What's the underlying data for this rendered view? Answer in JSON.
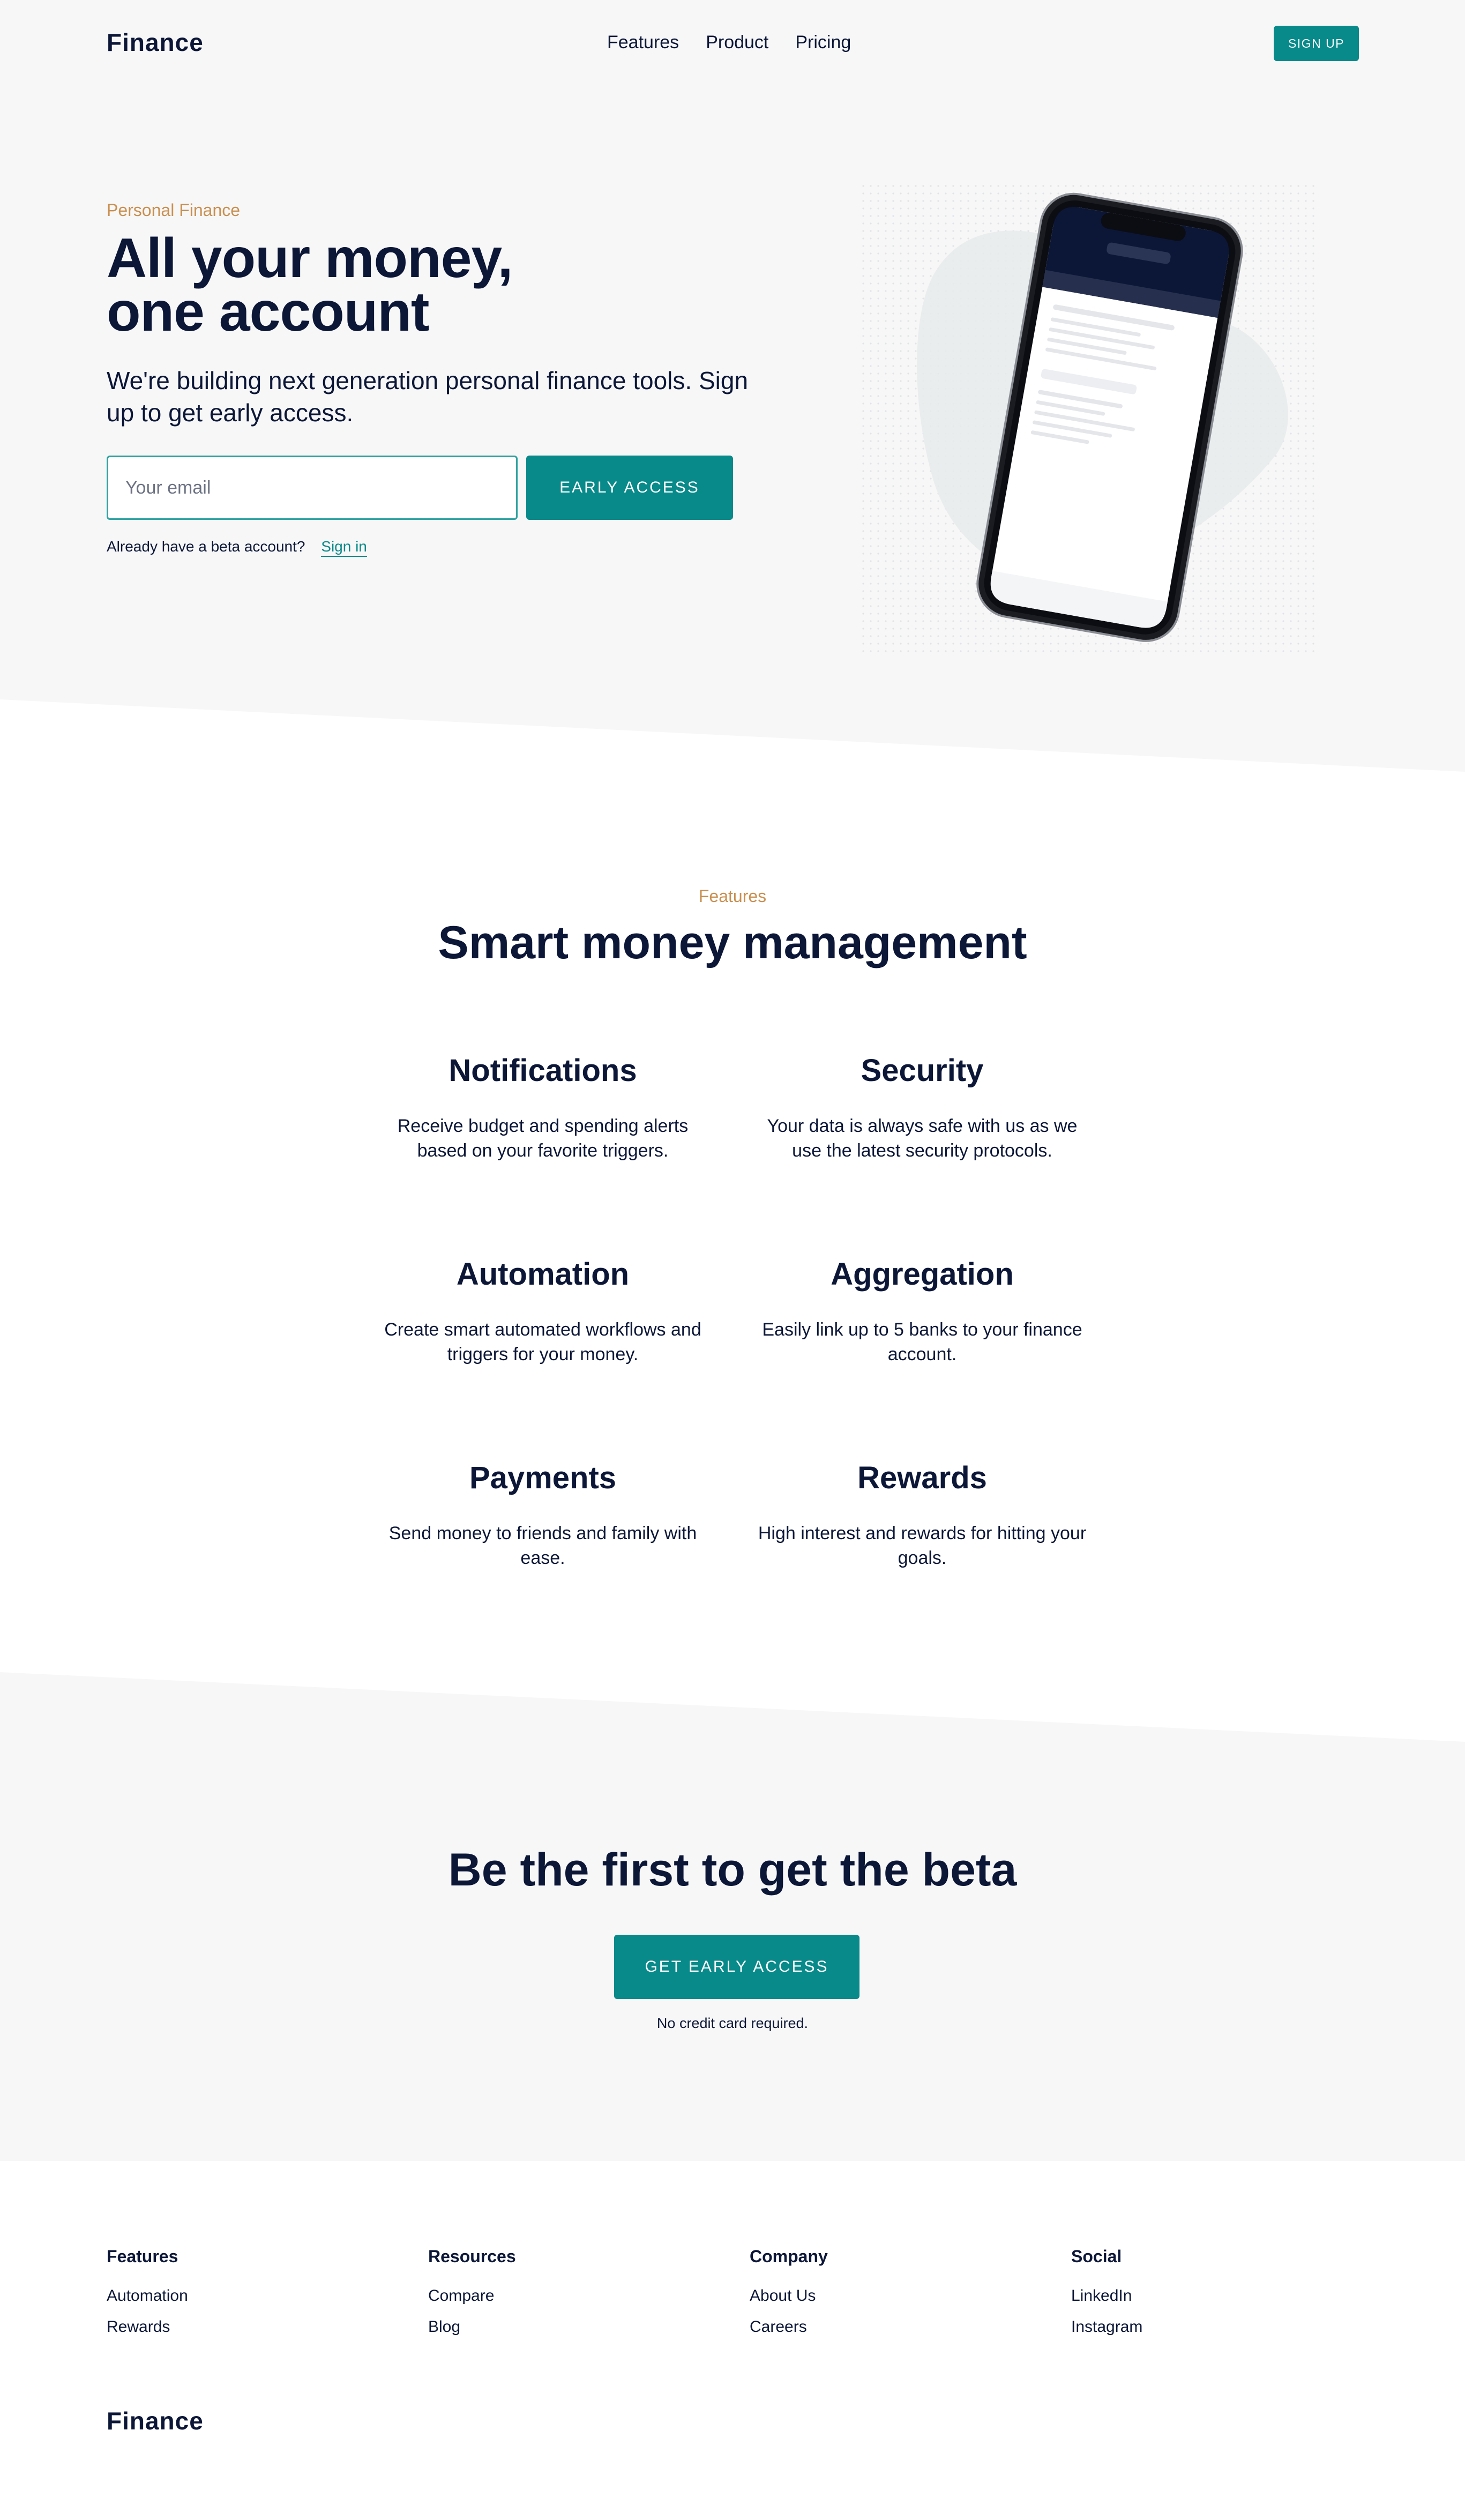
{
  "nav": {
    "logo": "Finance",
    "links": [
      "Features",
      "Product",
      "Pricing"
    ],
    "signup_label": "SIGN UP"
  },
  "hero": {
    "eyebrow": "Personal Finance",
    "title_line1": "All your money,",
    "title_line2": "one account",
    "subtitle": "We're building next generation personal finance tools. Sign up to get early access.",
    "email_placeholder": "Your email",
    "cta_label": "EARLY ACCESS",
    "beta_text": "Already have a beta account?",
    "signin_label": "Sign in"
  },
  "features": {
    "eyebrow": "Features",
    "title": "Smart money management",
    "items": [
      {
        "title": "Notifications",
        "description": "Receive budget and spending alerts based on your favorite triggers."
      },
      {
        "title": "Security",
        "description": "Your data is always safe with us as we use the latest security protocols."
      },
      {
        "title": "Automation",
        "description": "Create smart automated workflows and triggers for your money."
      },
      {
        "title": "Aggregation",
        "description": "Easily link up to 5 banks to your finance account."
      },
      {
        "title": "Payments",
        "description": "Send money to friends and family with ease."
      },
      {
        "title": "Rewards",
        "description": "High interest and rewards for hitting your goals."
      }
    ]
  },
  "cta": {
    "title": "Be the first to get the beta",
    "button_label": "GET EARLY ACCESS",
    "note": "No credit card required."
  },
  "footer": {
    "columns": [
      {
        "heading": "Features",
        "links": [
          "Automation",
          "Rewards"
        ]
      },
      {
        "heading": "Resources",
        "links": [
          "Compare",
          "Blog"
        ]
      },
      {
        "heading": "Company",
        "links": [
          "About Us",
          "Careers"
        ]
      },
      {
        "heading": "Social",
        "links": [
          "LinkedIn",
          "Instagram"
        ]
      }
    ],
    "logo": "Finance"
  },
  "colors": {
    "accent": "#08898a",
    "eyebrow": "#c98f4f",
    "text": "#0c1738",
    "section_bg": "#f7f7f7"
  }
}
